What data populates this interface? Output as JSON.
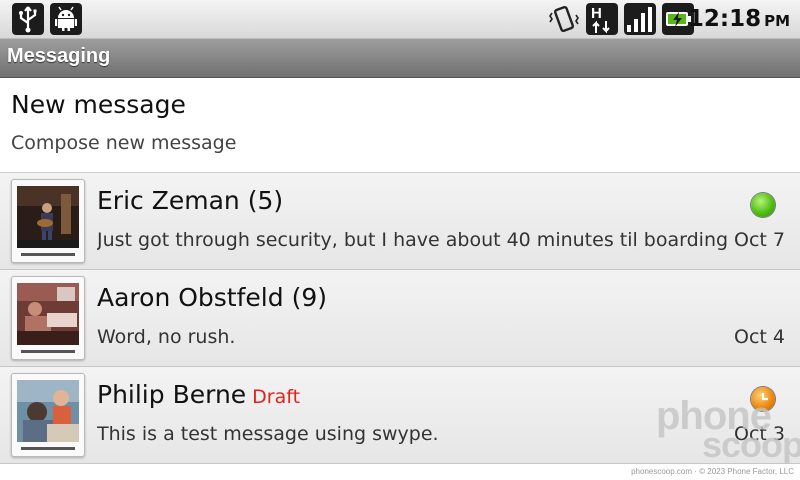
{
  "status_bar": {
    "left_icons": [
      "usb-icon",
      "android-debug-icon"
    ],
    "right_icons": [
      "vibrate-icon",
      "hspa-data-icon",
      "signal-icon",
      "battery-charging-icon"
    ],
    "time": "12:18",
    "ampm": "PM"
  },
  "title_bar": {
    "title": "Messaging"
  },
  "new_message": {
    "title": "New message",
    "subtitle": "Compose new message"
  },
  "conversations": [
    {
      "name": "Eric Zeman",
      "count": "(5)",
      "draft": "",
      "snippet": "Just got through security, but I have about 40 minutes til boarding....",
      "date": "Oct 7",
      "status": "green"
    },
    {
      "name": "Aaron Obstfeld",
      "count": "(9)",
      "draft": "",
      "snippet": "Word, no rush.",
      "date": "Oct 4",
      "status": ""
    },
    {
      "name": "Philip Berne",
      "count": "",
      "draft": "Draft",
      "snippet": "This is a test message using swype.",
      "date": "Oct 3",
      "status": "orange"
    }
  ],
  "colors": {
    "draft": "#e0231b",
    "status_green": "#4fbf13",
    "status_orange": "#ee8a11",
    "title_bar": "#8a8a8a"
  },
  "watermark": {
    "line1": "phone",
    "line2": "scoop",
    "footer": "phonescoop.com · © 2023 Phone Factor, LLC"
  }
}
